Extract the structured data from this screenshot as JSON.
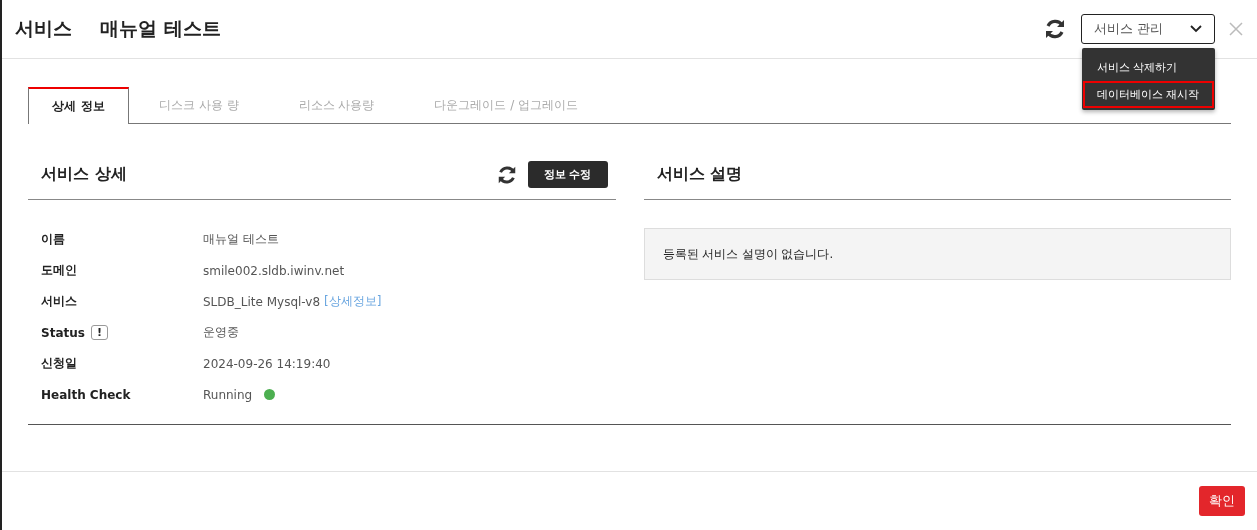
{
  "header": {
    "title": "서비스",
    "subtitle": "매뉴얼 테스트",
    "manage_select": {
      "value": "서비스 관리",
      "expanded": true
    },
    "menu": [
      {
        "label": "서비스 삭제하기",
        "selected": false
      },
      {
        "label": "데이터베이스 재시작",
        "selected": true
      }
    ]
  },
  "tabs": [
    {
      "label": "상세 정보",
      "selected": true
    },
    {
      "label": "디스크 사용 량",
      "selected": false
    },
    {
      "label": "리소스 사용량",
      "selected": false
    },
    {
      "label": "다운그레이드 / 업그레이드",
      "selected": false
    }
  ],
  "details": {
    "title": "서비스 상세",
    "edit_button": "정보 수정",
    "rows": [
      {
        "kind": "text",
        "label": "이름",
        "value": "매뉴얼 테스트"
      },
      {
        "kind": "text",
        "label": "도메인",
        "value": "smile002.sldb.iwinv.net"
      },
      {
        "kind": "link",
        "label": "서비스",
        "value": "SLDB_Lite Mysql-v8",
        "link": "[상세정보]"
      },
      {
        "kind": "info",
        "label": "Status",
        "icon_text": "!",
        "value": "운영중"
      },
      {
        "kind": "text",
        "label": "신청일",
        "value": "2024-09-26 14:19:40"
      },
      {
        "kind": "dot",
        "label": "Health Check",
        "value": "Running",
        "color": "#4caf50"
      }
    ]
  },
  "description": {
    "title": "서비스 설명",
    "text": "등록된 서비스 설명이 없습니다."
  },
  "footer": {
    "confirm_button": "확인"
  }
}
